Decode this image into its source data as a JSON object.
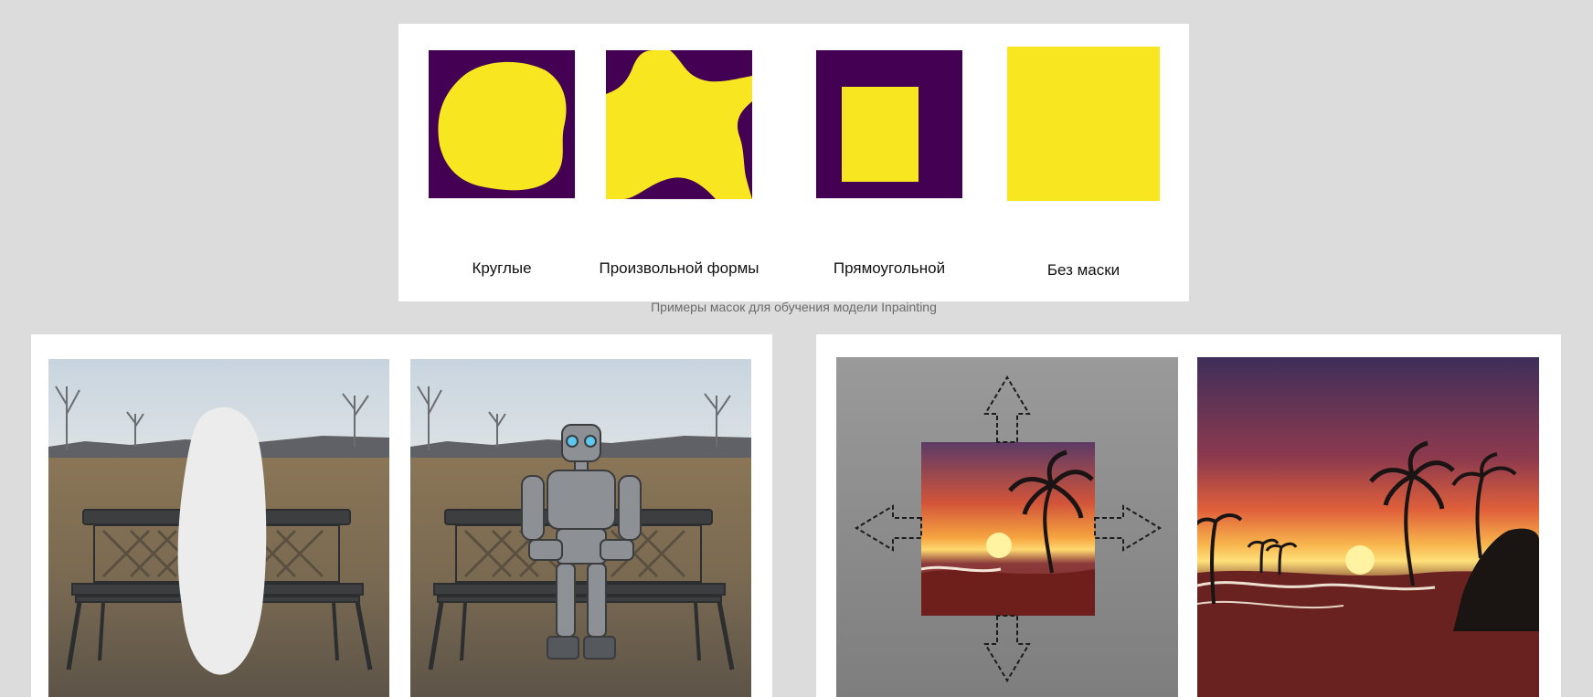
{
  "masks": {
    "items": [
      {
        "label": "Круглые"
      },
      {
        "label": "Произвольной формы"
      },
      {
        "label": "Прямоугольной"
      },
      {
        "label": "Без маски"
      }
    ],
    "caption": "Примеры масок для обучения модели Inpainting",
    "colors": {
      "background": "#440154",
      "mask": "#f8e621"
    }
  },
  "examples": {
    "inpainting": {
      "original_image": "bench-with-mask-image",
      "result_image": "robot-on-bench-image"
    },
    "outpainting": {
      "source_image": "sunset-beach-small-image",
      "arrows": [
        "arrow-up-icon",
        "arrow-down-icon",
        "arrow-left-icon",
        "arrow-right-icon"
      ],
      "result_image": "sunset-beach-extended-image"
    }
  }
}
